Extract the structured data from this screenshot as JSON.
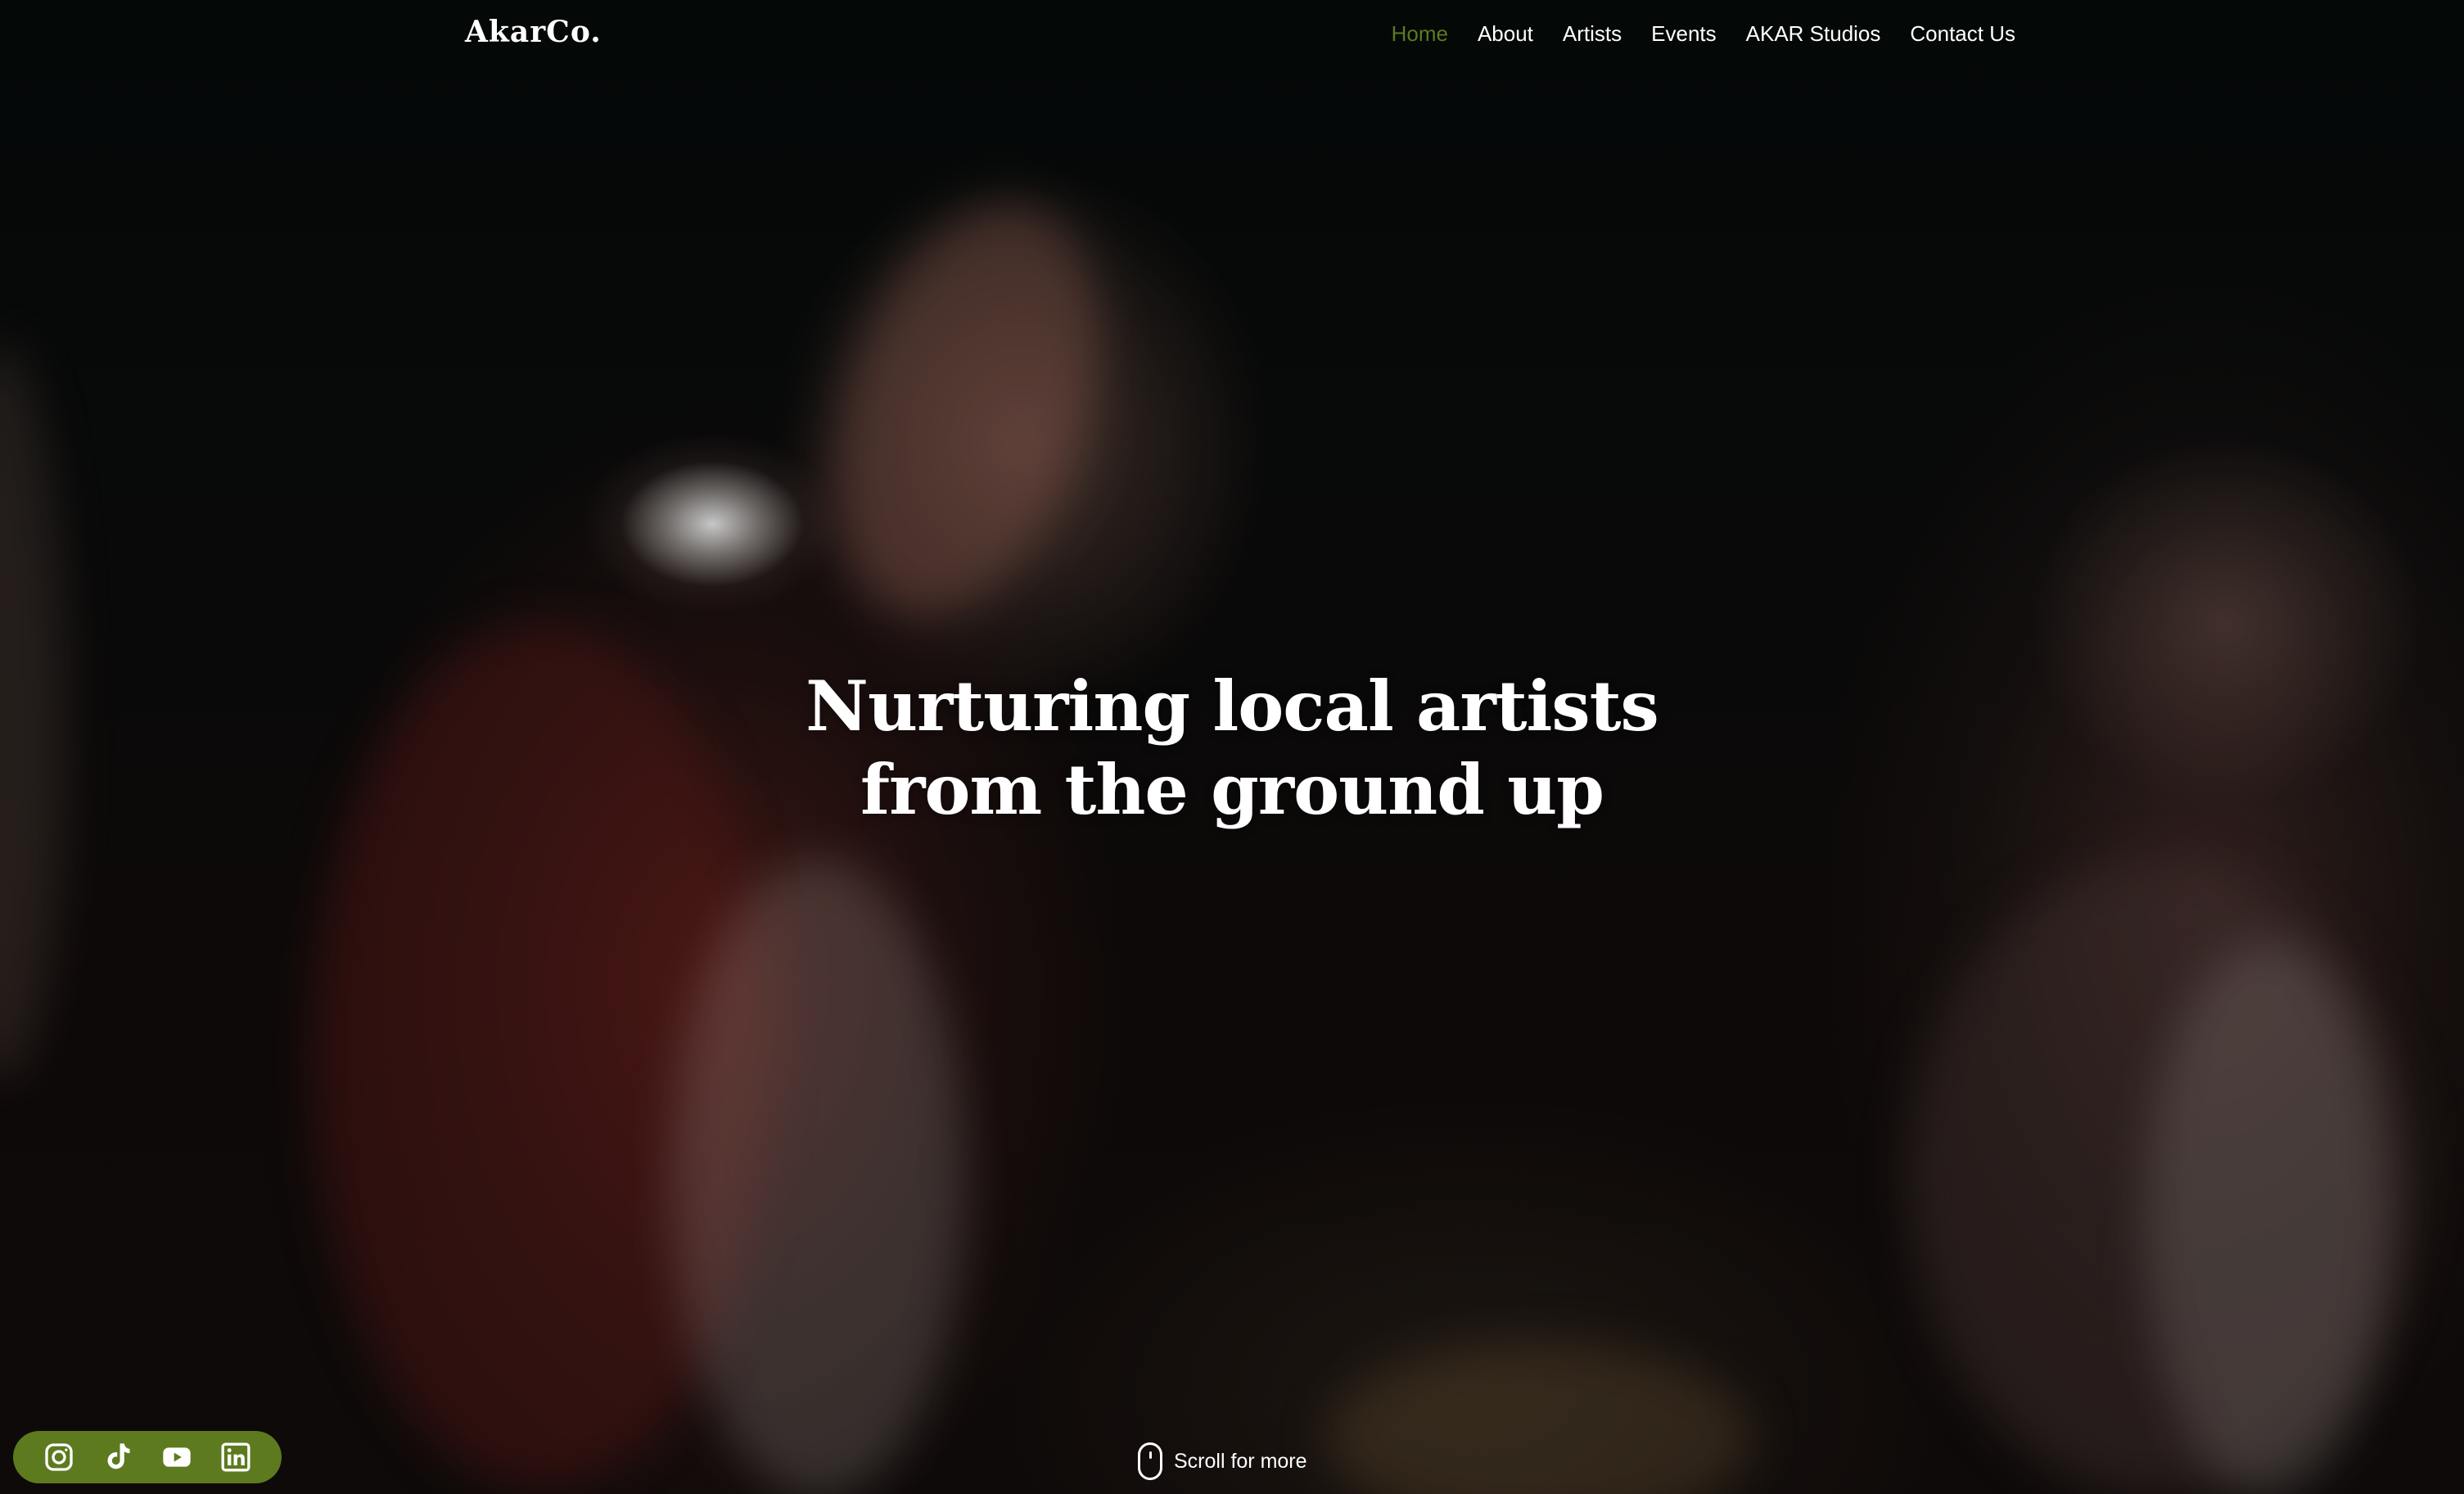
{
  "brand": {
    "logo_text": "AkarCo.",
    "accent_color": "#5d7a1f"
  },
  "nav": {
    "items": [
      {
        "label": "Home",
        "active": true
      },
      {
        "label": "About",
        "active": false
      },
      {
        "label": "Artists",
        "active": false
      },
      {
        "label": "Events",
        "active": false
      },
      {
        "label": "AKAR Studios",
        "active": false
      },
      {
        "label": "Contact Us",
        "active": false
      }
    ]
  },
  "hero": {
    "headline_line1": "Nurturing local artists",
    "headline_line2": "from the ground up"
  },
  "scroll": {
    "label": "Scroll for more",
    "icon": "mouse-icon"
  },
  "social": {
    "icons": [
      "instagram-icon",
      "tiktok-icon",
      "youtube-icon",
      "linkedin-icon"
    ]
  }
}
